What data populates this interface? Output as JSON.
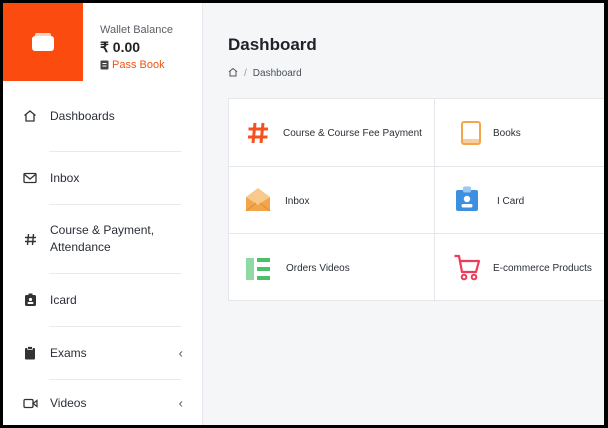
{
  "wallet": {
    "label": "Wallet Balance",
    "amount": "₹ 0.00",
    "passbook_label": "Pass Book",
    "brand_color": "#fb4b0e"
  },
  "sidebar": {
    "items": [
      {
        "icon": "home-icon",
        "label": "Dashboards"
      },
      {
        "icon": "mail-icon",
        "label": "Inbox"
      },
      {
        "icon": "hash-icon",
        "label": "Course & Payment, Attendance"
      },
      {
        "icon": "id-badge-icon",
        "label": "Icard"
      },
      {
        "icon": "clipboard-icon",
        "label": "Exams",
        "chevron": "‹"
      },
      {
        "icon": "video-icon",
        "label": "Videos",
        "chevron": "‹"
      }
    ]
  },
  "main": {
    "title": "Dashboard",
    "breadcrumb": {
      "home_icon": "home-icon",
      "separator": "/",
      "current": "Dashboard"
    }
  },
  "tiles": [
    {
      "icon": "hash-icon",
      "label": "Course & Course Fee Payment",
      "color": "#f4511e"
    },
    {
      "icon": "book-icon",
      "label": "Books",
      "color": "#f3a64a"
    },
    {
      "icon": "envelope-open-icon",
      "label": "Inbox",
      "color": "#f2a54a"
    },
    {
      "icon": "id-card-icon",
      "label": "I Card",
      "color": "#3d8fe0"
    },
    {
      "icon": "list-icon",
      "label": "Orders Videos",
      "color": "#4cbf6b"
    },
    {
      "icon": "cart-icon",
      "label": "E-commerce Products",
      "color": "#ef3b5a"
    }
  ]
}
